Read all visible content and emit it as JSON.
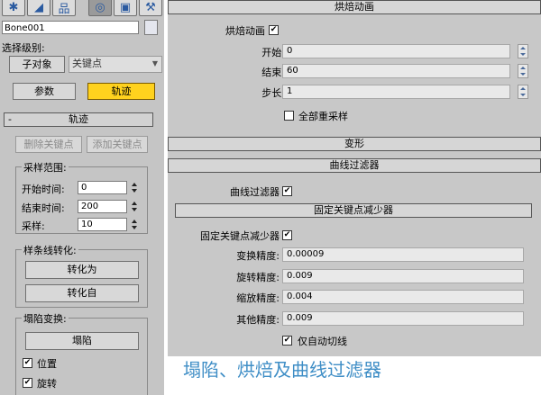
{
  "left_panel": {
    "toolbar_icons": [
      "create-icon",
      "modify-icon",
      "hierarchy-icon",
      "motion-icon",
      "display-icon",
      "utilities-icon"
    ],
    "object_name": "Bone001",
    "selection_level_label": "选择级别:",
    "sub_object_button": "子对象",
    "sub_object_dropdown_value": "关键点",
    "params_button": "参数",
    "trajectories_button": "轨迹",
    "rollout_minus": "-",
    "rollout_title": "轨迹",
    "delete_key_button": "删除关键点",
    "add_key_button": "添加关键点",
    "sample_range": {
      "label": "采样范围:",
      "start_label": "开始时间:",
      "start_value": "0",
      "end_label": "结束时间:",
      "end_value": "200",
      "samples_label": "采样:",
      "samples_value": "10"
    },
    "spline_conversion": {
      "label": "样条线转化:",
      "convert_to": "转化为",
      "convert_from": "转化自"
    },
    "collapse_transform": {
      "label": "塌陷变换:",
      "collapse_button": "塌陷",
      "position_label": "位置",
      "position_checked": true,
      "rotation_label": "旋转",
      "rotation_checked": true
    }
  },
  "right_panel": {
    "bake_header": "烘焙动画",
    "bake_label": "烘焙动画",
    "bake_checked": true,
    "start_label": "开始:",
    "start_value": "0",
    "end_label": "结束:",
    "end_value": "60",
    "step_label": "步长:",
    "step_value": "1",
    "resample_label": "全部重采样",
    "resample_checked": false,
    "deform_header": "变形",
    "curve_filter_header": "曲线过滤器",
    "curve_filter_label": "曲线过滤器",
    "curve_filter_checked": true,
    "fixed_key_header": "固定关键点减少器",
    "fixed_key_label": "固定关键点减少器",
    "fixed_key_checked": true,
    "transform_precision_label": "变换精度:",
    "transform_precision_value": "0.00009",
    "rotation_precision_label": "旋转精度:",
    "rotation_precision_value": "0.009",
    "scale_precision_label": "缩放精度:",
    "scale_precision_value": "0.004",
    "other_precision_label": "其他精度:",
    "other_precision_value": "0.009",
    "auto_tangent_label": "仅自动切线",
    "auto_tangent_checked": true
  },
  "caption": "塌陷、烘焙及曲线过滤器",
  "colors": {
    "active_button": "#ffd21e",
    "caption": "#3f8ec6",
    "panel_bg": "#c5c5c5"
  }
}
